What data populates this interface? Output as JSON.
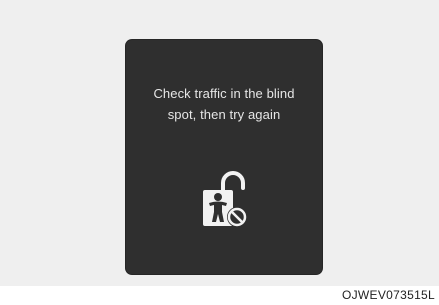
{
  "message": {
    "line1": "Check traffic in the blind",
    "line2": "spot, then try again"
  },
  "icon": {
    "name": "child-lock-prohibited-icon"
  },
  "figure_code": "OJWEV073515L",
  "colors": {
    "background": "#efefef",
    "panel": "#2f2f2f",
    "text": "#e6e6e6",
    "icon": "#f2f2f2"
  }
}
